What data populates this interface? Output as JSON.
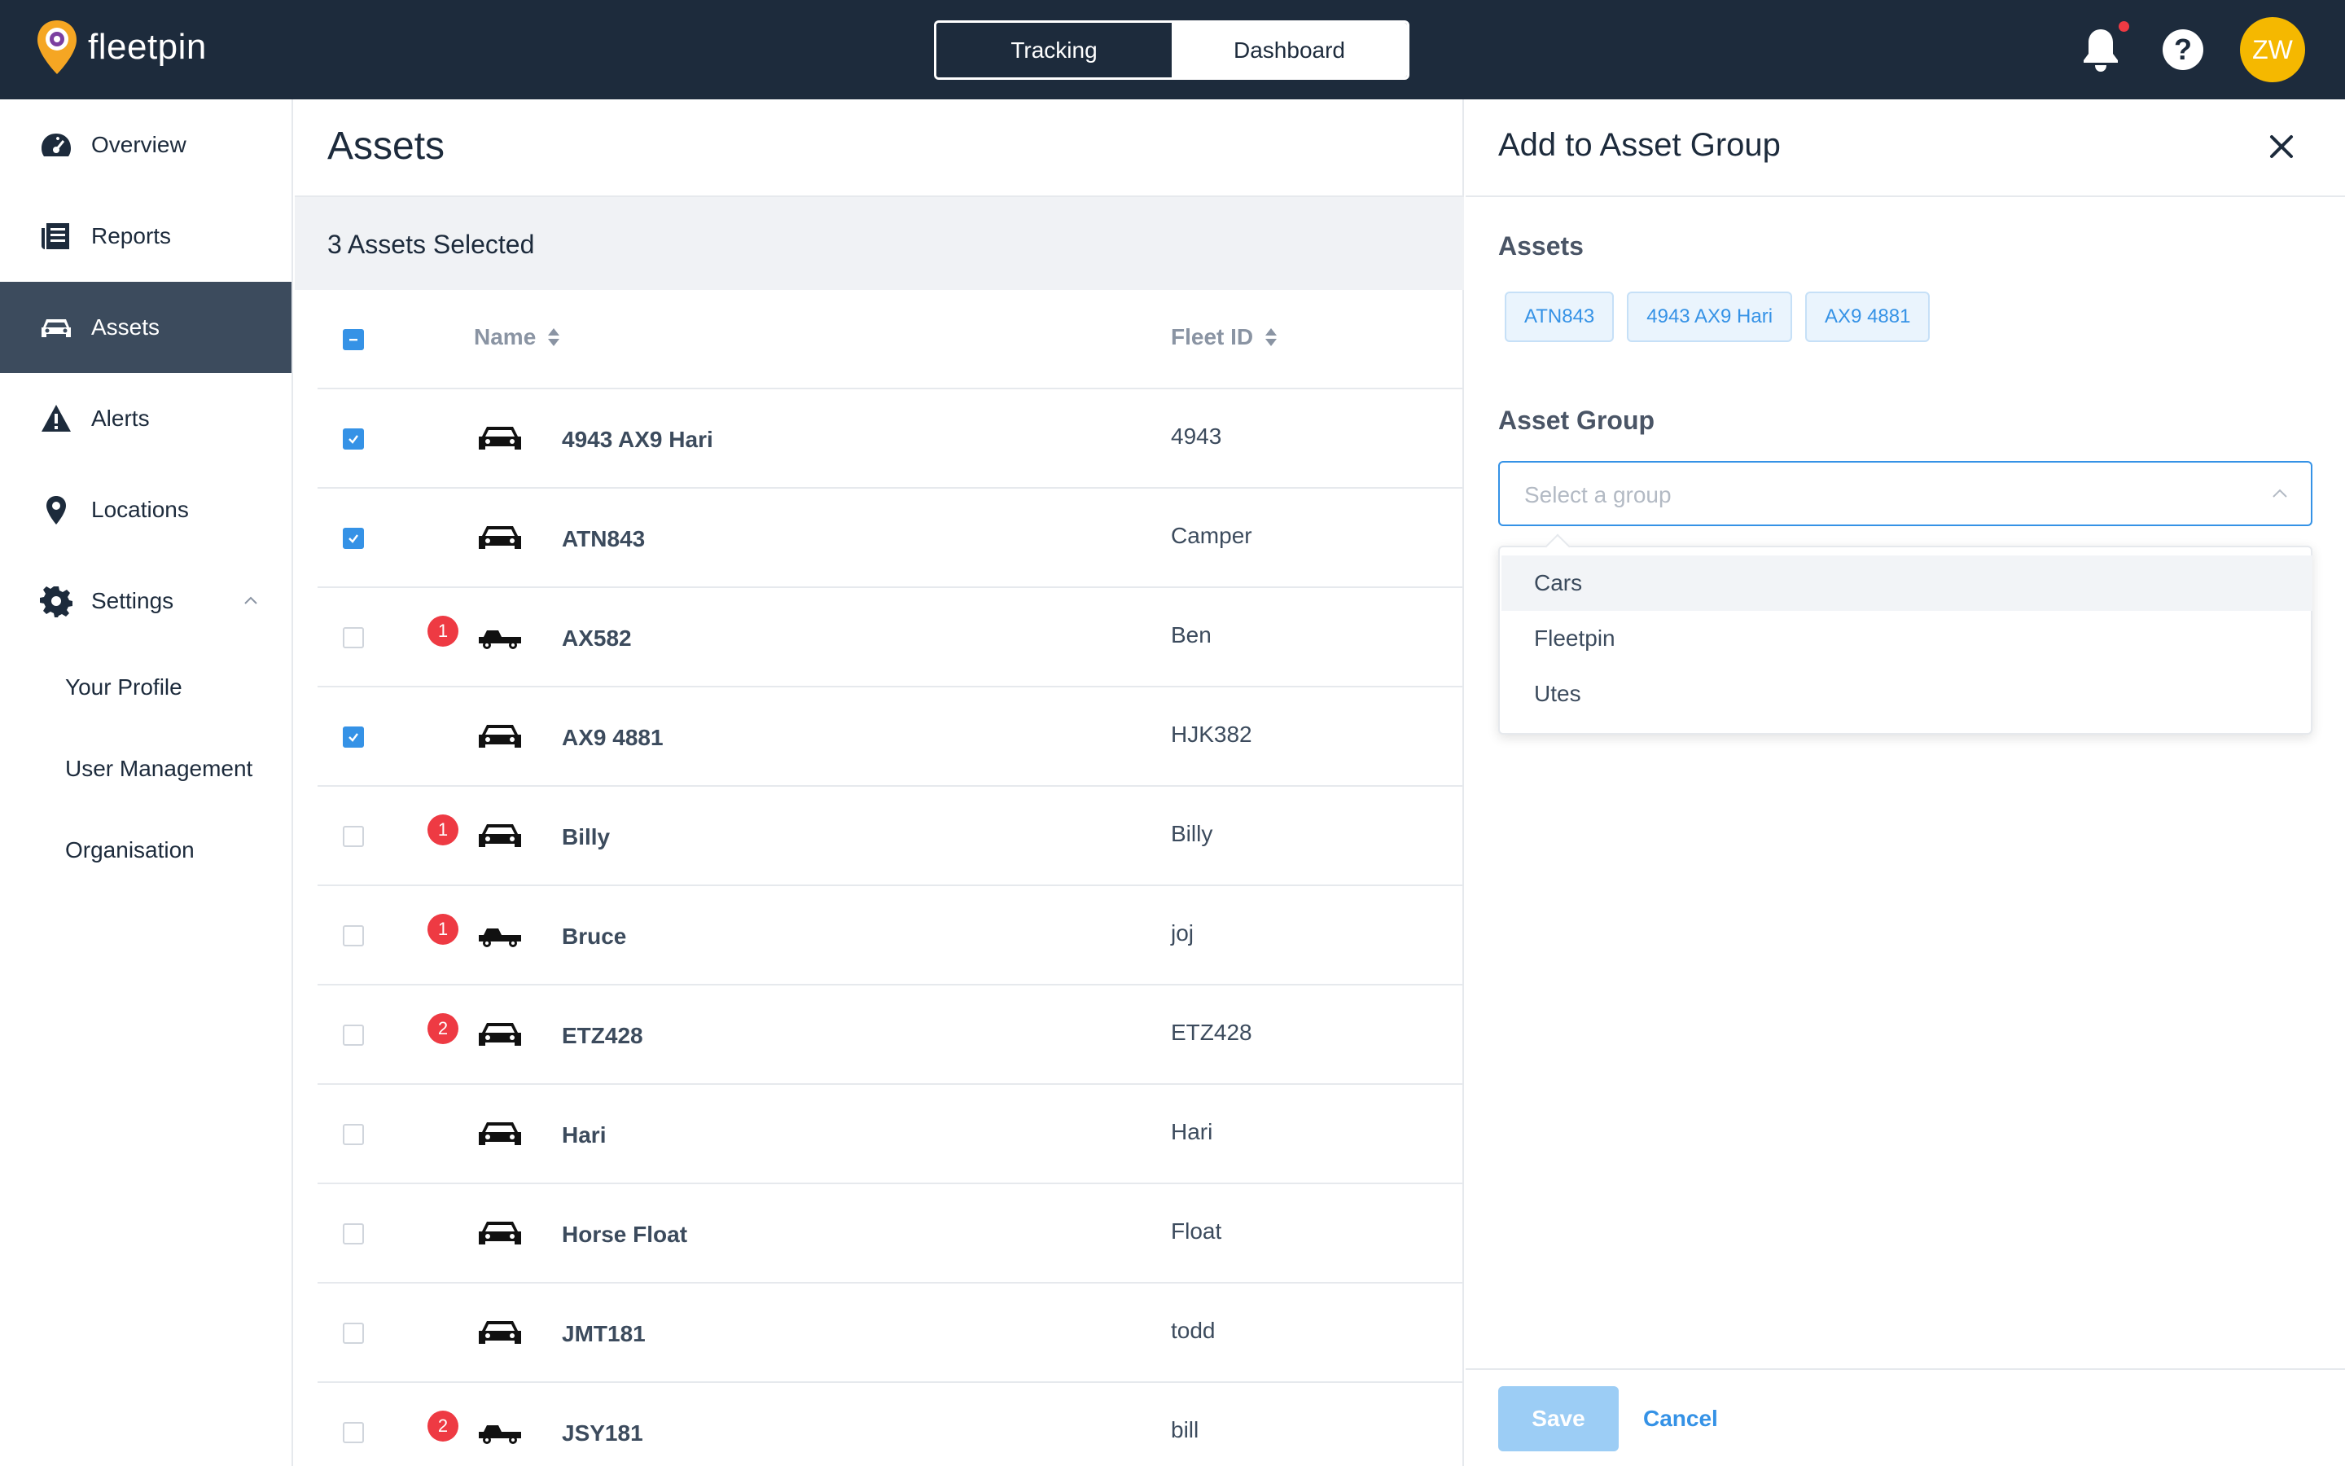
{
  "brand": {
    "name": "fleetpin",
    "accent": "#f5b800",
    "pin_color": "#f5a623"
  },
  "topbar": {
    "tabs": [
      {
        "label": "Tracking",
        "active": true
      },
      {
        "label": "Dashboard",
        "active": false
      }
    ],
    "notification_dot_color": "#ee3a43",
    "help_label": "?",
    "avatar_initials": "ZW"
  },
  "sidebar": {
    "items": [
      {
        "label": "Overview",
        "icon": "speedometer-icon"
      },
      {
        "label": "Reports",
        "icon": "reports-icon"
      },
      {
        "label": "Assets",
        "icon": "car-icon",
        "active": true
      },
      {
        "label": "Alerts",
        "icon": "warning-icon"
      },
      {
        "label": "Locations",
        "icon": "location-pin-icon"
      },
      {
        "label": "Settings",
        "icon": "gear-icon",
        "expanded": true
      }
    ],
    "settings_children": [
      "Your Profile",
      "User Management",
      "Organisation"
    ]
  },
  "main": {
    "title": "Assets",
    "selection_text": "3 Assets Selected",
    "columns": {
      "name": "Name",
      "fleet_id": "Fleet ID"
    },
    "rows": [
      {
        "name": "4943 AX9 Hari",
        "fleet_id": "4943",
        "checked": true,
        "badge": "",
        "vehicle": "car"
      },
      {
        "name": "ATN843",
        "fleet_id": "Camper",
        "checked": true,
        "badge": "",
        "vehicle": "car"
      },
      {
        "name": "AX582",
        "fleet_id": "Ben",
        "checked": false,
        "badge": "1",
        "vehicle": "ute"
      },
      {
        "name": "AX9 4881",
        "fleet_id": "HJK382",
        "checked": true,
        "badge": "",
        "vehicle": "car"
      },
      {
        "name": "Billy",
        "fleet_id": "Billy",
        "checked": false,
        "badge": "1",
        "vehicle": "car"
      },
      {
        "name": "Bruce",
        "fleet_id": "joj",
        "checked": false,
        "badge": "1",
        "vehicle": "ute"
      },
      {
        "name": "ETZ428",
        "fleet_id": "ETZ428",
        "checked": false,
        "badge": "2",
        "vehicle": "car"
      },
      {
        "name": "Hari",
        "fleet_id": "Hari",
        "checked": false,
        "badge": "",
        "vehicle": "car"
      },
      {
        "name": "Horse Float",
        "fleet_id": "Float",
        "checked": false,
        "badge": "",
        "vehicle": "car"
      },
      {
        "name": "JMT181",
        "fleet_id": "todd",
        "checked": false,
        "badge": "",
        "vehicle": "car"
      },
      {
        "name": "JSY181",
        "fleet_id": "bill",
        "checked": false,
        "badge": "2",
        "vehicle": "ute"
      }
    ]
  },
  "panel": {
    "title": "Add to Asset Group",
    "assets_label": "Assets",
    "asset_chips": [
      "ATN843",
      "4943 AX9 Hari",
      "AX9 4881"
    ],
    "group_label": "Asset Group",
    "select_placeholder": "Select a group",
    "options": [
      "Cars",
      "Fleetpin",
      "Utes"
    ],
    "save_label": "Save",
    "cancel_label": "Cancel"
  }
}
